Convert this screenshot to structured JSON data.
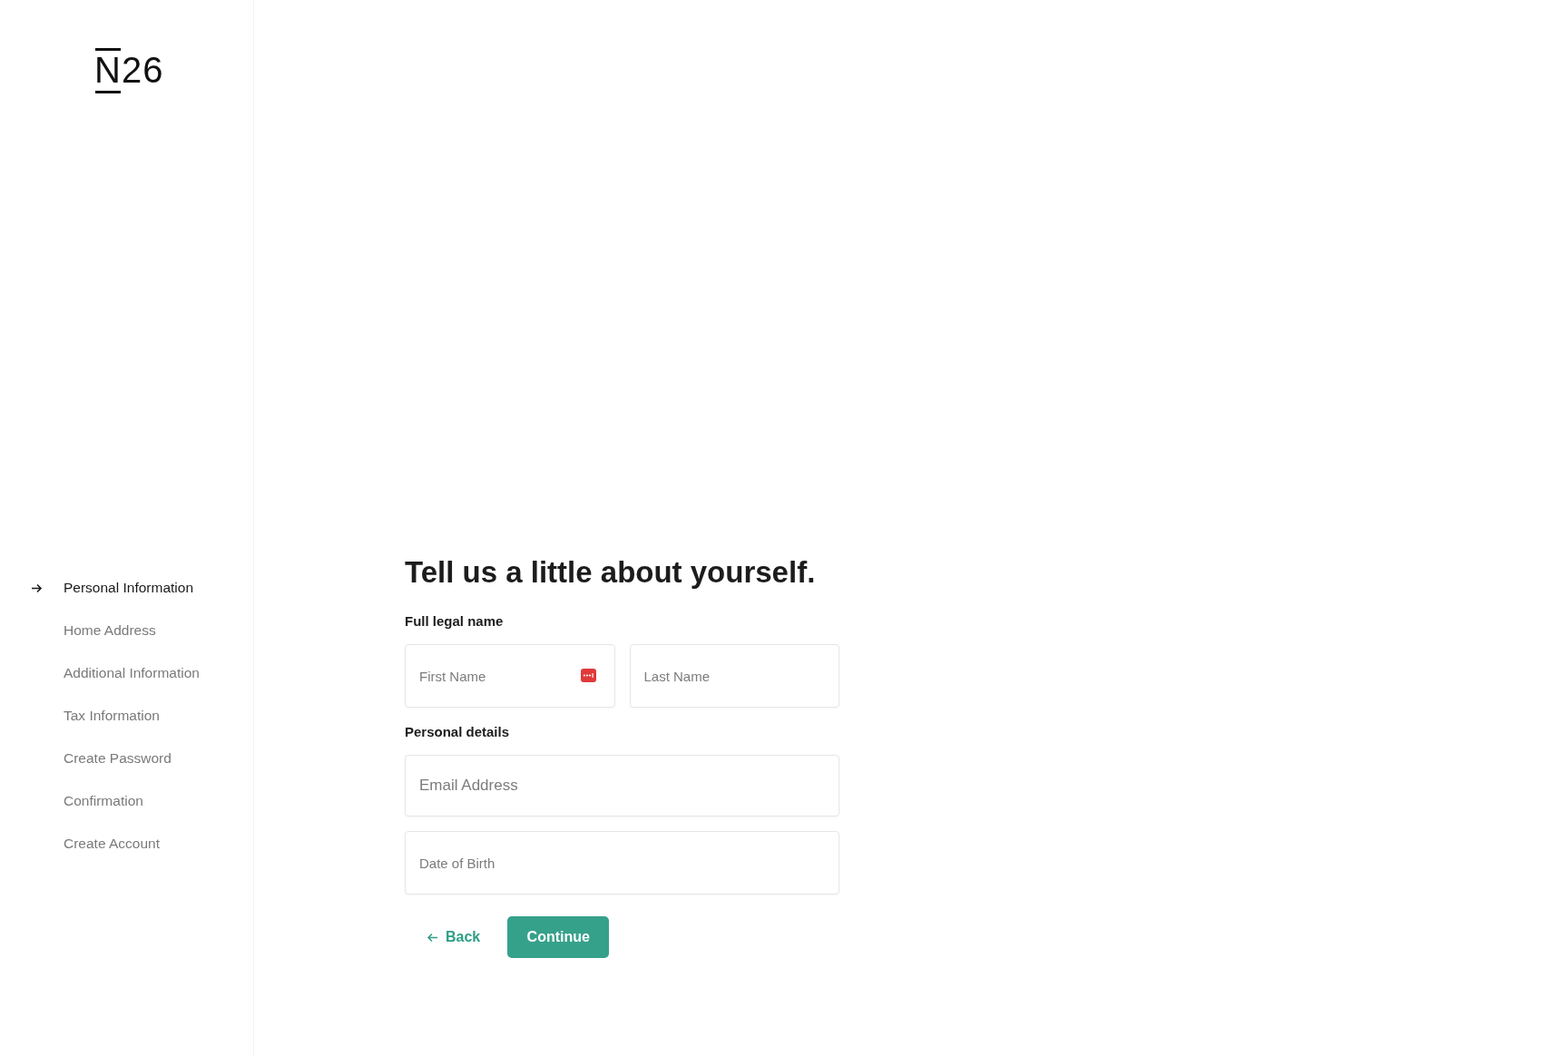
{
  "logo": "N26",
  "steps": [
    {
      "label": "Personal Information",
      "selected": true
    },
    {
      "label": "Home Address",
      "selected": false
    },
    {
      "label": "Additional Information",
      "selected": false
    },
    {
      "label": "Tax Information",
      "selected": false
    },
    {
      "label": "Create Password",
      "selected": false
    },
    {
      "label": "Confirmation",
      "selected": false
    },
    {
      "label": "Create Account",
      "selected": false
    }
  ],
  "heading": "Tell us a little about yourself.",
  "sections": [
    {
      "label": "Full legal name",
      "fields": [
        {
          "placeholder": "First Name",
          "autofill_icon": true
        },
        {
          "placeholder": "Last Name",
          "autofill_icon": false
        }
      ]
    },
    {
      "label": "Personal details",
      "fields": [
        {
          "placeholder": "Email Address",
          "autofill_icon": false,
          "large": true
        },
        {
          "placeholder": "Date of Birth",
          "autofill_icon": false
        }
      ]
    }
  ],
  "back_button": "Back",
  "continue_button": "Continue"
}
